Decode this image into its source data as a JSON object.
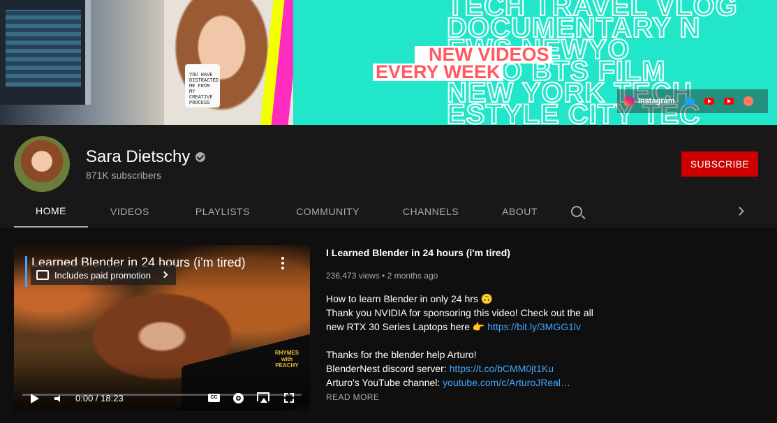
{
  "banner": {
    "big_text_lines": [
      "TECH TRAVEL VLOG",
      "DOCUMENTARY N",
      "EWS NEWYO",
      "W-TO BTS FILM",
      "NEW YORK TECH",
      "ESTYLE CITY TEC"
    ],
    "mug_text": "YOU HAVE DISTRACTED ME FROM MY CREATIVE PROCESS",
    "tagline_1": "NEW VIDEOS",
    "tagline_2": "EVERY WEEK",
    "social_instagram": "Instagram",
    "colors": {
      "teal": "#21e6c9",
      "coral": "#ff5a5f",
      "yellow": "#f3ff00",
      "pink": "#ff2dbf"
    }
  },
  "channel": {
    "name": "Sara Dietschy",
    "subscribers": "871K subscribers",
    "subscribe_label": "SUBSCRIBE",
    "subscribe_color": "#cc0000"
  },
  "tabs": [
    {
      "label": "HOME",
      "active": true
    },
    {
      "label": "VIDEOS",
      "active": false
    },
    {
      "label": "PLAYLISTS",
      "active": false
    },
    {
      "label": "COMMUNITY",
      "active": false
    },
    {
      "label": "CHANNELS",
      "active": false
    },
    {
      "label": "ABOUT",
      "active": false
    }
  ],
  "featured": {
    "player_title": "Learned Blender in 24 hours (i'm tired)",
    "promo": "Includes paid promotion",
    "watermark": "RHYMES with PEACHY",
    "time": "0:00 / 18:23",
    "cc_label": "CC",
    "progress_fraction": 0,
    "title": "I Learned Blender in 24 hours (i'm tired)",
    "meta": "236,473 views • 2 months ago",
    "desc_line1": "How to learn Blender in only 24 hrs 🙃",
    "desc_line2": "Thank you NVIDIA for sponsoring this video! Check out the all",
    "desc_line3_text": "new RTX 30 Series Laptops here 👉 ",
    "desc_line3_link": "https://bit.ly/3MGG1lv",
    "desc_line4": "Thanks for the blender help Arturo!",
    "desc_line5_text": "BlenderNest discord server: ",
    "desc_line5_link": "https://t.co/bCMM0jt1Ku",
    "desc_line6_text": "Arturo's YouTube channel: ",
    "desc_line6_link": "youtube.com/c/ArturoJReal…",
    "read_more": "READ MORE",
    "link_color": "#3ea6ff"
  }
}
